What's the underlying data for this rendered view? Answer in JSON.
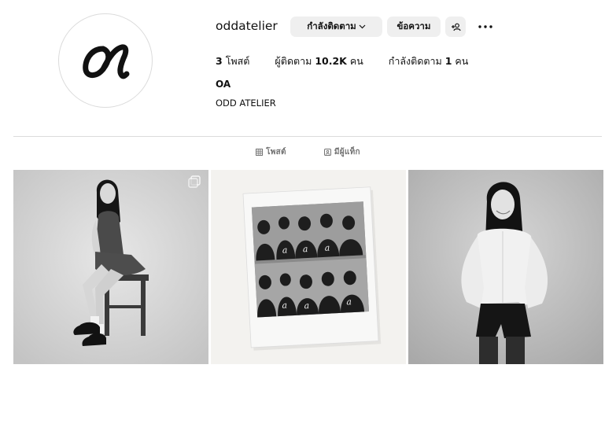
{
  "profile": {
    "username": "oddatelier",
    "full_name": "OA",
    "bio": "ODD ATELIER"
  },
  "actions": {
    "following_label": "กำลังติดตาม",
    "message_label": "ข้อความ"
  },
  "stats": {
    "posts_count": "3",
    "posts_label": "โพสต์",
    "followers_label": "ผู้ติดตาม",
    "followers_count": "10.2K",
    "followers_unit": "คน",
    "following_label": "กำลังติดตาม",
    "following_count": "1",
    "following_unit": "คน"
  },
  "tabs": [
    {
      "label": "โพสต์",
      "icon": "grid-icon",
      "active": true
    },
    {
      "label": "มีผู้แท็ก",
      "icon": "tagged-icon",
      "active": false
    }
  ],
  "posts": [
    {
      "icon": "multi-image-icon",
      "description": "woman seated on stool"
    },
    {
      "description": "polaroid photo of group"
    },
    {
      "description": "woman in white shirt"
    }
  ],
  "colors": {
    "button_bg": "#efefef",
    "divider": "#dbdbdb",
    "muted": "#737373"
  }
}
